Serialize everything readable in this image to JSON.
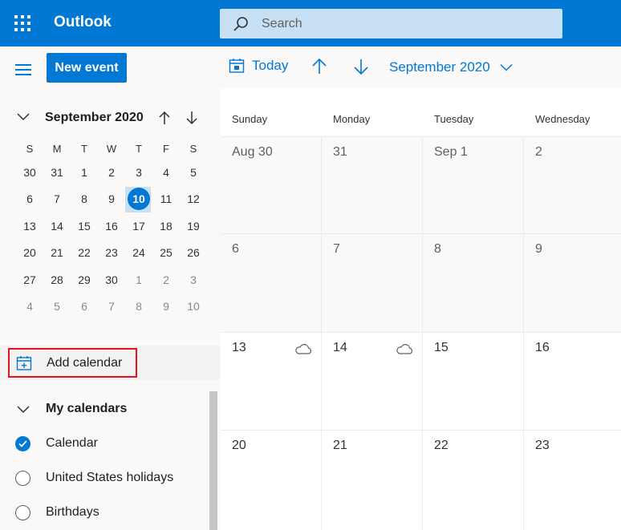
{
  "header": {
    "app_title": "Outlook",
    "search_placeholder": "Search",
    "accent": "#0078d4"
  },
  "left": {
    "new_event_label": "New event",
    "mini_calendar": {
      "title": "September 2020",
      "weekdays": [
        "S",
        "M",
        "T",
        "W",
        "T",
        "F",
        "S"
      ],
      "weeks": [
        [
          "30",
          "31",
          "1",
          "2",
          "3",
          "4",
          "5"
        ],
        [
          "6",
          "7",
          "8",
          "9",
          "10",
          "11",
          "12"
        ],
        [
          "13",
          "14",
          "15",
          "16",
          "17",
          "18",
          "19"
        ],
        [
          "20",
          "21",
          "22",
          "23",
          "24",
          "25",
          "26"
        ],
        [
          "27",
          "28",
          "29",
          "30",
          "1",
          "2",
          "3"
        ],
        [
          "4",
          "5",
          "6",
          "7",
          "8",
          "9",
          "10"
        ]
      ],
      "dim_cells": [
        [
          4,
          4
        ],
        [
          4,
          5
        ],
        [
          4,
          6
        ],
        [
          5,
          0
        ],
        [
          5,
          1
        ],
        [
          5,
          2
        ],
        [
          5,
          3
        ],
        [
          5,
          4
        ],
        [
          5,
          5
        ],
        [
          5,
          6
        ]
      ],
      "today": "10"
    },
    "add_calendar_label": "Add calendar",
    "my_calendars": {
      "title": "My calendars",
      "items": [
        {
          "label": "Calendar",
          "checked": true
        },
        {
          "label": "United States holidays",
          "checked": false
        },
        {
          "label": "Birthdays",
          "checked": false
        }
      ]
    }
  },
  "toolbar": {
    "today_label": "Today",
    "month_label": "September 2020"
  },
  "grid": {
    "weekdays": [
      "Sunday",
      "Monday",
      "Tuesday",
      "Wednesday"
    ],
    "weeks": [
      [
        "Aug 30",
        "31",
        "Sep 1",
        "2"
      ],
      [
        "6",
        "7",
        "8",
        "9"
      ],
      [
        "13",
        "14",
        "15",
        "16"
      ],
      [
        "20",
        "21",
        "22",
        "23"
      ]
    ]
  }
}
